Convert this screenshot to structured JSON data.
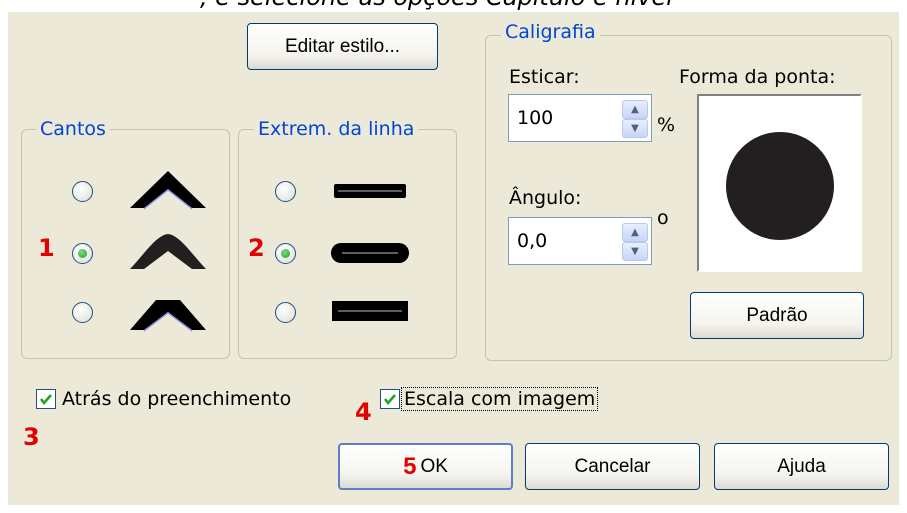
{
  "caption_fragment": ", e selecione as opções Capítulo e nível",
  "buttons": {
    "edit_style": "Editar estilo...",
    "default_nib": "Padrão",
    "ok": "OK",
    "cancel": "Cancelar",
    "help": "Ajuda"
  },
  "corners": {
    "title": "Cantos",
    "options": [
      {
        "icon": "corner-miter-icon",
        "checked": false
      },
      {
        "icon": "corner-round-icon",
        "checked": true
      },
      {
        "icon": "corner-bevel-icon",
        "checked": false
      }
    ]
  },
  "line_caps": {
    "title": "Extrem. da linha",
    "options": [
      {
        "icon": "cap-butt-icon",
        "checked": false
      },
      {
        "icon": "cap-round-icon",
        "checked": true
      },
      {
        "icon": "cap-square-icon",
        "checked": false
      }
    ]
  },
  "calligraphy": {
    "title": "Caligrafia",
    "stretch_label": "Esticar:",
    "stretch_value": "100",
    "stretch_unit": "%",
    "angle_label": "Ângulo:",
    "angle_value": "0,0",
    "angle_unit": "o",
    "nib_shape_label": "Forma da ponta:"
  },
  "checkboxes": {
    "behind_fill": {
      "label": "Atrás do preenchimento",
      "checked": true
    },
    "scale_with_image": {
      "label": "Escala com imagem",
      "checked": true
    }
  },
  "markers": [
    "1",
    "2",
    "3",
    "4",
    "5"
  ],
  "colors": {
    "dialog_bg": "#ece9d8",
    "group_title": "#0046d5",
    "marker": "#e30000",
    "check": "#21a121"
  }
}
